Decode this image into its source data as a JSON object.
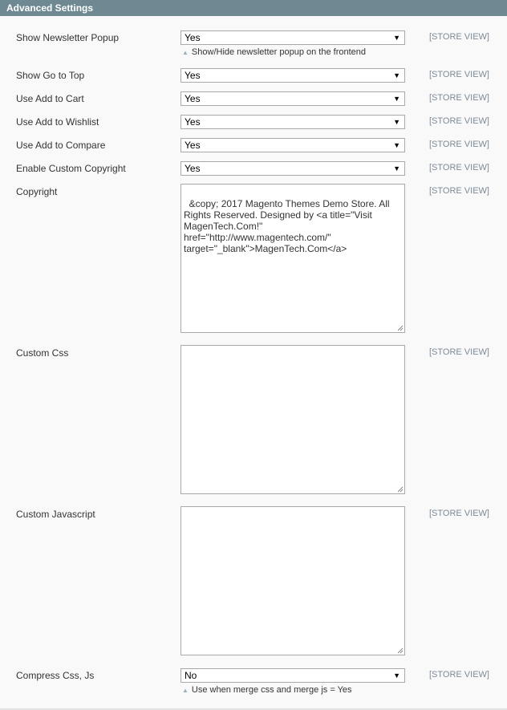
{
  "section": {
    "title": "Advanced Settings"
  },
  "scope_label": "[STORE VIEW]",
  "fields": {
    "newsletter_popup": {
      "label": "Show Newsletter Popup",
      "value": "Yes",
      "note": "Show/Hide newsletter popup on the frontend"
    },
    "go_to_top": {
      "label": "Show Go to Top",
      "value": "Yes"
    },
    "add_to_cart": {
      "label": "Use Add to Cart",
      "value": "Yes"
    },
    "add_to_wishlist": {
      "label": "Use Add to Wishlist",
      "value": "Yes"
    },
    "add_to_compare": {
      "label": "Use Add to Compare",
      "value": "Yes"
    },
    "custom_copyright": {
      "label": "Enable Custom Copyright",
      "value": "Yes"
    },
    "copyright": {
      "label": "Copyright",
      "value": "&copy; 2017 Magento Themes Demo Store. All Rights Reserved. Designed by <a title=\"Visit MagenTech.Com!\" href=\"http://www.magentech.com/\" target=\"_blank\">MagenTech.Com</a>"
    },
    "custom_css": {
      "label": "Custom Css",
      "value": ""
    },
    "custom_js": {
      "label": "Custom Javascript",
      "value": ""
    },
    "compress": {
      "label": "Compress Css, Js",
      "value": "No",
      "note": "Use when merge css and merge js = Yes"
    }
  },
  "icons": {
    "dropdown": "chevron-down-icon",
    "note": "triangle-up-icon",
    "resize": "resize-handle-icon"
  }
}
